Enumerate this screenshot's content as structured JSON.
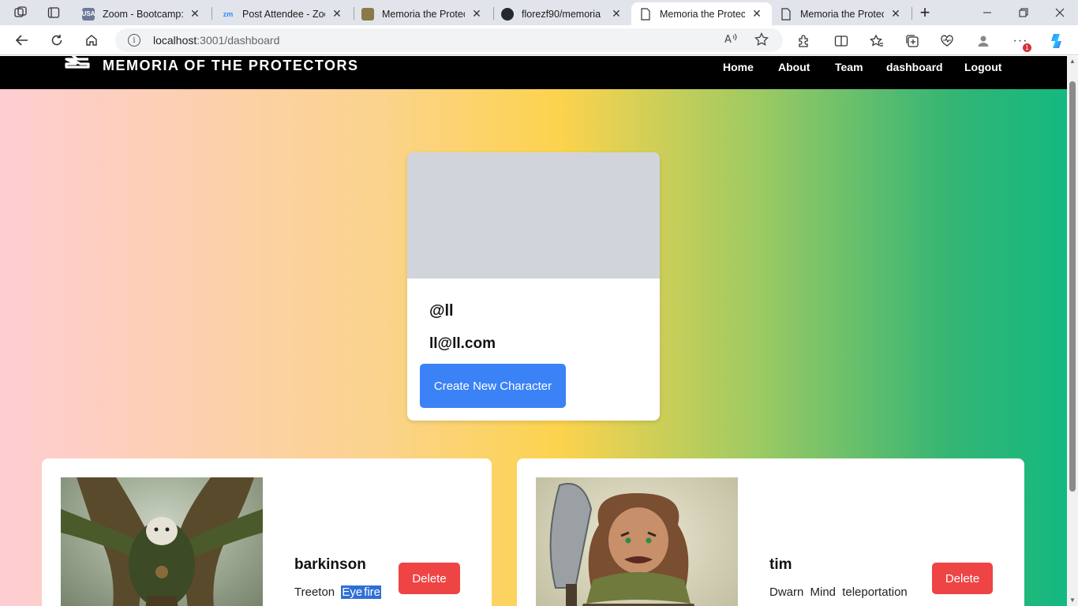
{
  "browser": {
    "tabs": [
      {
        "title": "Zoom - Bootcamp: U",
        "favicon": "zoom-bootcamp-favicon",
        "active": false
      },
      {
        "title": "Post Attendee - Zoom",
        "favicon": "zoom-favicon",
        "active": false
      },
      {
        "title": "Memoria the Protecto",
        "favicon": "image-favicon",
        "active": false
      },
      {
        "title": "florezf90/memoria",
        "favicon": "github-favicon",
        "active": false
      },
      {
        "title": "Memoria the Protecto",
        "favicon": "page-favicon",
        "active": true
      },
      {
        "title": "Memoria the Protecto",
        "favicon": "page-favicon",
        "active": false
      }
    ],
    "favicon_labels": {
      "zoom_bootcamp": "USA",
      "zoom": "zm"
    },
    "close_glyph": "✕",
    "new_tab_glyph": "+",
    "url_host": "localhost",
    "url_path": ":3001/dashboard",
    "notification_count": "1",
    "icons": [
      "workspaces-icon",
      "tab-actions-icon",
      "back-icon",
      "refresh-icon",
      "home-icon",
      "info-icon",
      "read-aloud-icon",
      "favorite-star-icon",
      "extensions-icon",
      "split-screen-icon",
      "favorites-icon",
      "collections-icon",
      "performance-icon",
      "profile-icon",
      "more-icon",
      "copilot-icon"
    ]
  },
  "site": {
    "brand": "MEMORIA OF THE PROTECTORS",
    "nav": [
      "Home",
      "About",
      "Team",
      "dashboard",
      "Logout"
    ]
  },
  "profile": {
    "username": "@ll",
    "email": "ll@ll.com",
    "create_button": "Create New Character"
  },
  "characters": [
    {
      "name": "barkinson",
      "description_plain": "Treeton",
      "description_selected": [
        "Eye",
        "fire"
      ],
      "delete_label": "Delete"
    },
    {
      "name": "tim",
      "description_plain": "Dwarn Mind teleportation",
      "description_selected": [],
      "delete_label": "Delete"
    }
  ],
  "colors": {
    "nav_bg": "#000000",
    "primary_button": "#3b82f6",
    "danger_button": "#ef4444",
    "gradient": [
      "#fecdd3",
      "#fcd34d",
      "#10b981"
    ]
  }
}
